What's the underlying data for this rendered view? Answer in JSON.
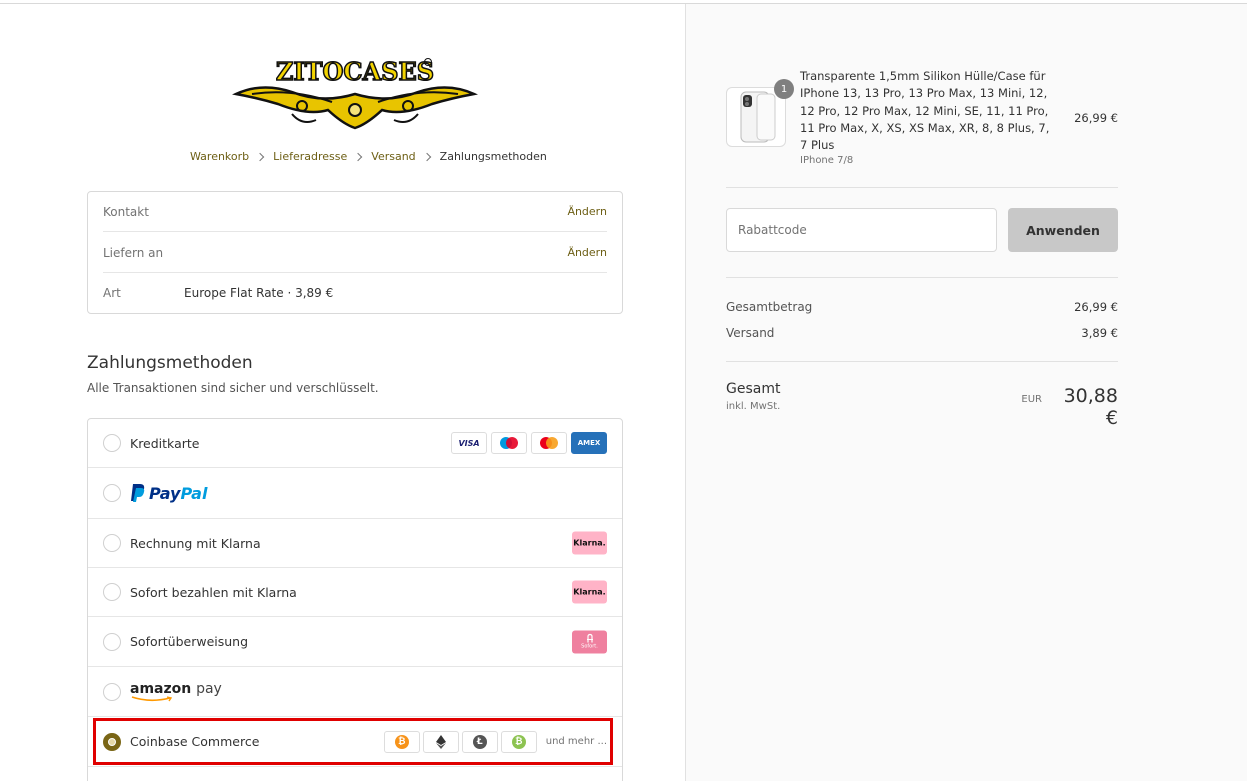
{
  "brand": {
    "logo_text": "ZITOCASES",
    "accent": "#6d5f15",
    "selected": "#7a6616"
  },
  "breadcrumb": [
    {
      "label": "Warenkorb"
    },
    {
      "label": "Lieferadresse"
    },
    {
      "label": "Versand"
    },
    {
      "label": "Zahlungsmethoden"
    }
  ],
  "review": {
    "rows": [
      {
        "label": "Kontakt",
        "value": "",
        "action": "Ändern"
      },
      {
        "label": "Liefern an",
        "value": "",
        "action": "Ändern"
      },
      {
        "label": "Art",
        "value": "Europe Flat Rate · 3,89 €",
        "action": ""
      }
    ]
  },
  "payment": {
    "title": "Zahlungsmethoden",
    "subtitle": "Alle Transaktionen sind sicher und verschlüsselt.",
    "methods": [
      {
        "label": "Kreditkarte",
        "icons": [
          "VISA",
          "maestro",
          "mastercard",
          "AMEX"
        ]
      },
      {
        "label": "PayPal",
        "pay_prefix": "Pay",
        "pay_suffix": "Pal"
      },
      {
        "label": "Rechnung mit Klarna",
        "badge": "Klarna."
      },
      {
        "label": "Sofort bezahlen mit Klarna",
        "badge": "Klarna."
      },
      {
        "label": "Sofortüberweisung",
        "badge": "Sofort."
      },
      {
        "label": "amazon pay",
        "amazon": "amazon",
        "pay": "pay"
      },
      {
        "label": "Coinbase Commerce",
        "more": "und mehr ...",
        "coins": [
          "bitcoin-icon",
          "ethereum-icon",
          "litecoin-icon",
          "bitcoin-cash-icon"
        ]
      }
    ]
  },
  "order": {
    "quantity": "1",
    "product_name": "Transparente 1,5mm Silikon Hülle/Case für IPhone 13, 13 Pro, 13 Pro Max, 13 Mini, 12, 12 Pro, 12 Pro Max, 12 Mini, SE, 11, 11 Pro, 11 Pro Max, X, XS, XS Max, XR, 8, 8 Plus, 7, 7 Plus",
    "variant": "IPhone 7/8",
    "price": "26,99 €",
    "discount_placeholder": "Rabattcode",
    "apply_label": "Anwenden",
    "subtotal_label": "Gesamtbetrag",
    "subtotal_value": "26,99 €",
    "shipping_label": "Versand",
    "shipping_value": "3,89 €",
    "total_label": "Gesamt",
    "total_sub": "inkl. MwSt.",
    "currency": "EUR",
    "total_value": "30,88 €"
  }
}
